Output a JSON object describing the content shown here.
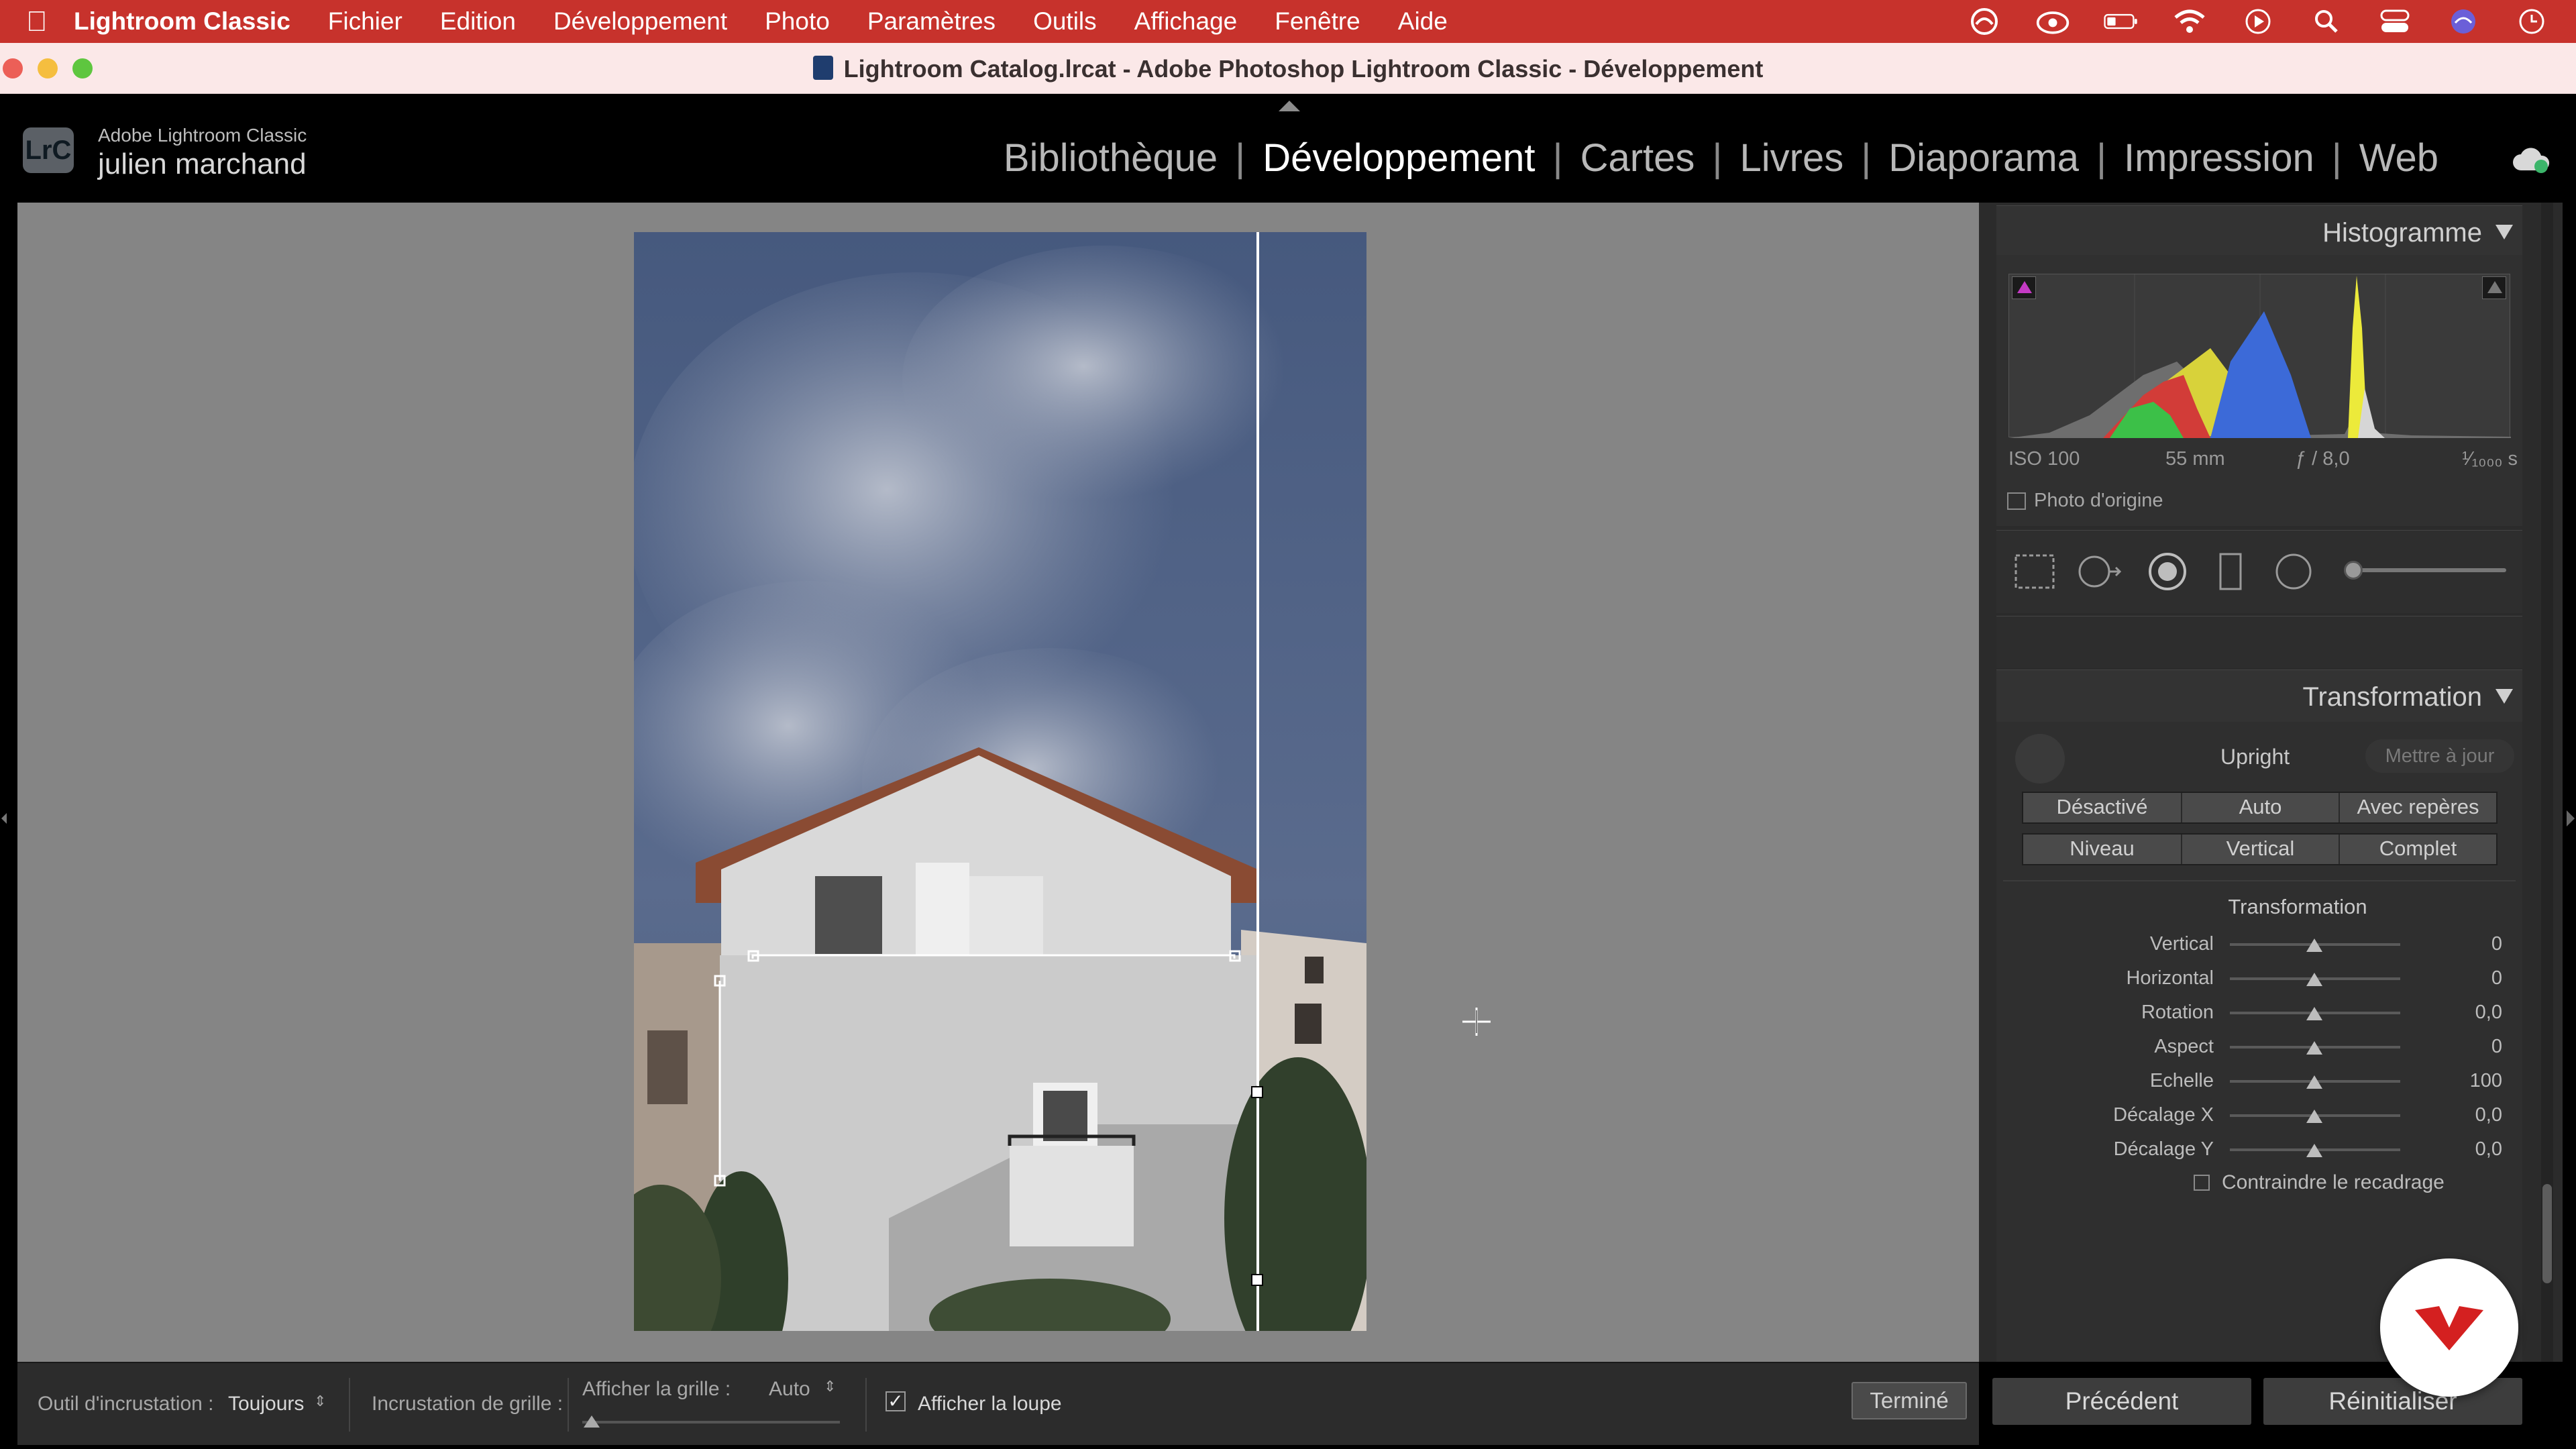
{
  "menubar": {
    "app": "Lightroom Classic",
    "items": [
      "Fichier",
      "Edition",
      "Développement",
      "Photo",
      "Paramètres",
      "Outils",
      "Affichage",
      "Fenêtre",
      "Aide"
    ]
  },
  "window": {
    "title": "Lightroom Catalog.lrcat - Adobe Photoshop Lightroom Classic - Développement"
  },
  "identity": {
    "logo": "LrC",
    "product": "Adobe Lightroom Classic",
    "user": "julien marchand"
  },
  "modules": {
    "items": [
      "Bibliothèque",
      "Développement",
      "Cartes",
      "Livres",
      "Diaporama",
      "Impression",
      "Web"
    ],
    "active": "Développement"
  },
  "histogram": {
    "title": "Histogramme",
    "iso": "ISO 100",
    "focal": "55 mm",
    "aperture": "ƒ / 8,0",
    "shutter": "¹⁄₁₀₀₀ s",
    "original_label": "Photo d'origine"
  },
  "transform_panel": {
    "title": "Transformation",
    "upright_label": "Upright",
    "update_label": "Mettre à jour",
    "row1": [
      "Désactivé",
      "Auto",
      "Avec repères"
    ],
    "row2": [
      "Niveau",
      "Vertical",
      "Complet"
    ],
    "section_label": "Transformation",
    "sliders": [
      {
        "label": "Vertical",
        "value": "0"
      },
      {
        "label": "Horizontal",
        "value": "0"
      },
      {
        "label": "Rotation",
        "value": "0,0"
      },
      {
        "label": "Aspect",
        "value": "0"
      },
      {
        "label": "Echelle",
        "value": "100"
      },
      {
        "label": "Décalage X",
        "value": "0,0"
      },
      {
        "label": "Décalage Y",
        "value": "0,0"
      }
    ],
    "constrain_label": "Contraindre le recadrage"
  },
  "nav": {
    "previous": "Précédent",
    "reset": "Réinitialiser"
  },
  "toolbar": {
    "overlay_label": "Outil d'incrustation :",
    "overlay_value": "Toujours",
    "grid_overlay_label": "Incrustation de grille :",
    "show_grid_label": "Afficher la grille :",
    "show_grid_value": "Auto",
    "loupe_label": "Afficher la loupe",
    "done_label": "Terminé"
  },
  "colors": {
    "menubar": "#c7322c",
    "canvas": "#858585",
    "panel": "#2b2b2b"
  }
}
